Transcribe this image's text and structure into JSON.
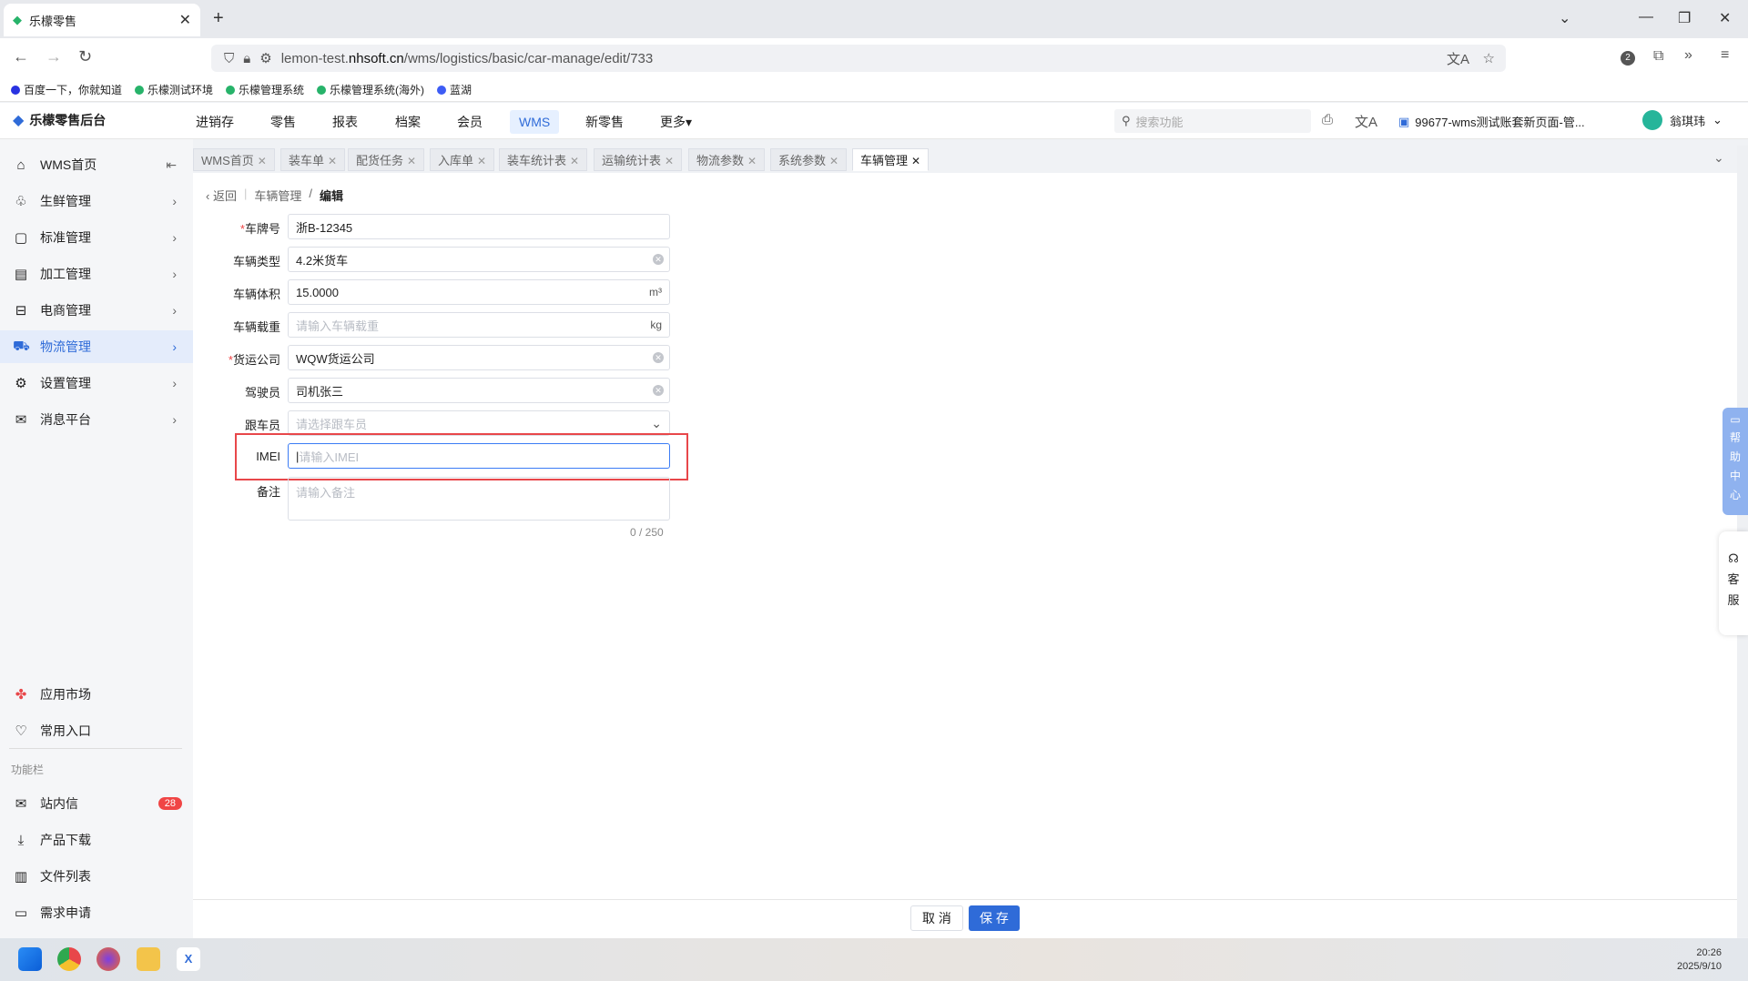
{
  "browser": {
    "tab_title": "乐檬零售",
    "url_prefix": "lemon-test.",
    "url_host": "nhsoft.cn",
    "url_path": "/wms/logistics/basic/car-manage/edit/733",
    "ext_badge": "2",
    "bookmarks": [
      "百度一下，你就知道",
      "乐檬测试环境",
      "乐檬管理系统",
      "乐檬管理系统(海外)",
      "蓝湖"
    ]
  },
  "app": {
    "logo": "乐檬零售后台",
    "menu": [
      "进销存",
      "零售",
      "报表",
      "档案",
      "会员",
      "WMS",
      "新零售",
      "更多"
    ],
    "active_menu": "WMS",
    "search_placeholder": "搜索功能",
    "account": "99677-wms测试账套新页面-管...",
    "user": "翁琪玮"
  },
  "sidebar": {
    "items": [
      "WMS首页",
      "生鲜管理",
      "标准管理",
      "加工管理",
      "电商管理",
      "物流管理",
      "设置管理",
      "消息平台"
    ],
    "active": "物流管理",
    "bottom_items": [
      "应用市场",
      "常用入口"
    ],
    "section_label": "功能栏",
    "func_items": [
      "站内信",
      "产品下载",
      "文件列表",
      "需求申请"
    ],
    "inbox_badge": "28"
  },
  "page_tabs": [
    "WMS首页",
    "装车单",
    "配货任务",
    "入库单",
    "装车统计表",
    "运输统计表",
    "物流参数",
    "系统参数",
    "车辆管理"
  ],
  "breadcrumb": {
    "back": "返回",
    "parent": "车辆管理",
    "sep": "/",
    "current": "编辑"
  },
  "form": {
    "plate_label": "车牌号",
    "plate_value": "浙B-12345",
    "type_label": "车辆类型",
    "type_value": "4.2米货车",
    "volume_label": "车辆体积",
    "volume_value": "15.0000",
    "volume_unit": "m³",
    "load_label": "车辆载重",
    "load_placeholder": "请输入车辆载重",
    "load_unit": "kg",
    "company_label": "货运公司",
    "company_value": "WQW货运公司",
    "driver_label": "驾驶员",
    "driver_value": "司机张三",
    "escort_label": "跟车员",
    "escort_placeholder": "请选择跟车员",
    "imei_label": "IMEI",
    "imei_placeholder": "请输入IMEI",
    "remark_label": "备注",
    "remark_placeholder": "请输入备注",
    "remark_counter": "0 / 250"
  },
  "footer": {
    "cancel": "取 消",
    "save": "保 存"
  },
  "float": {
    "help": [
      "帮",
      "助",
      "中",
      "心"
    ],
    "kefu": [
      "客",
      "服"
    ]
  },
  "clock": {
    "time": "20:26",
    "date": "2025/9/10"
  },
  "colors": {
    "primary": "#2f6bd8",
    "highlight_box": "#e8474a",
    "badge": "#f04545"
  }
}
